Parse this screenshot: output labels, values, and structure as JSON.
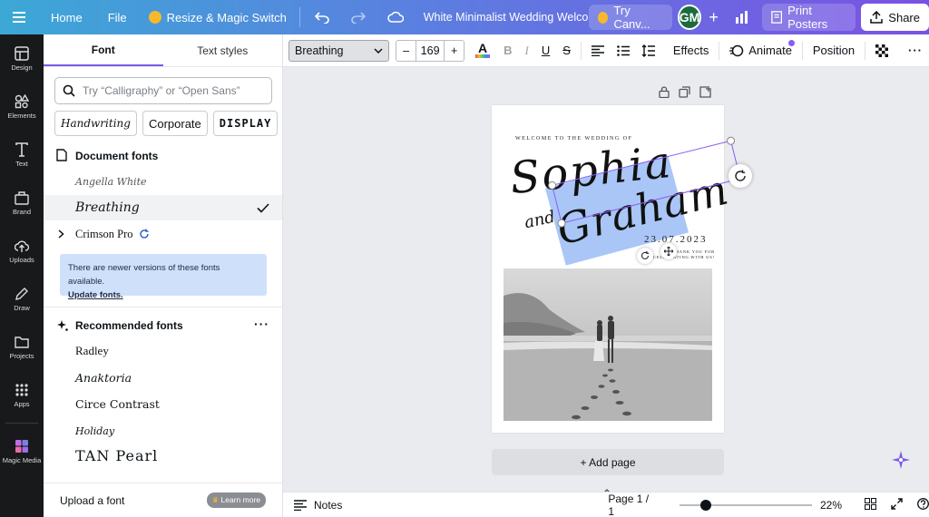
{
  "topbar": {
    "home": "Home",
    "file": "File",
    "resize": "Resize & Magic Switch",
    "title": "White Minimalist Wedding Welcome Sig...",
    "try": "Try Canv...",
    "avatar": "GM",
    "print": "Print Posters",
    "share": "Share"
  },
  "rail": [
    {
      "label": "Design"
    },
    {
      "label": "Elements"
    },
    {
      "label": "Text"
    },
    {
      "label": "Brand"
    },
    {
      "label": "Uploads"
    },
    {
      "label": "Draw"
    },
    {
      "label": "Projects"
    },
    {
      "label": "Apps"
    },
    {
      "label": "Magic Media"
    }
  ],
  "panel": {
    "tabs": [
      "Font",
      "Text styles"
    ],
    "search_placeholder": "Try “Calligraphy” or “Open Sans”",
    "chips": [
      "Handwriting",
      "Corporate",
      "DISPLAY"
    ],
    "document_fonts_title": "Document fonts",
    "document_fonts": [
      "Angella White",
      "Breathing",
      "Crimson Pro"
    ],
    "notice_text": "There are newer versions of these fonts available.",
    "notice_link": "Update fonts.",
    "recommended_title": "Recommended fonts",
    "recommended_fonts": [
      "Radley",
      "Anaktoria",
      "Circe Contrast",
      "Holiday",
      "TAN Pearl"
    ],
    "upload": "Upload a font",
    "learn_more": "Learn more"
  },
  "toolbar": {
    "font": "Breathing",
    "size": "169",
    "minus": "–",
    "plus": "+",
    "effects": "Effects",
    "animate": "Animate",
    "position": "Position"
  },
  "design": {
    "welcome": "WELCOME TO THE WEDDING OF",
    "name1": "Sophia",
    "and": "and",
    "name2": "Graham",
    "date": "23.07.2023",
    "thanks_line1": "THANK YOU FOR",
    "thanks_line2": "CELEBRATING WITH US!"
  },
  "canvas": {
    "add_page": "+ Add page"
  },
  "bottombar": {
    "notes": "Notes",
    "page": "Page 1 / 1",
    "zoom": "22%",
    "zoom_fraction": 0.2
  },
  "colors": {
    "accent": "#7b5be3",
    "highlight": "#a9c6f7",
    "selection": "#8b5cf6"
  }
}
